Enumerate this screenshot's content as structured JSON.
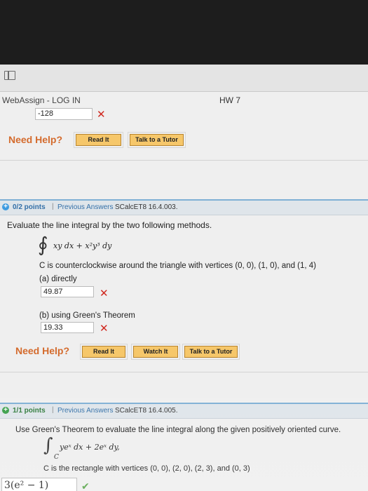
{
  "window": {
    "title_left": "WebAssign - LOG IN",
    "title_right": "HW 7"
  },
  "prev_problem": {
    "answer": "-128",
    "need_help": "Need Help?",
    "buttons": [
      "Read It",
      "Talk to a Tutor"
    ]
  },
  "q1": {
    "points": "0/2 points",
    "separator": "|",
    "previous_answers": "Previous Answers",
    "code": "SCalcET8 16.4.003.",
    "prompt": "Evaluate the line integral by the two following methods.",
    "integral_symbol": "∮",
    "integrand": "xy dx + x²y³ dy",
    "condition": "C is counterclockwise around the triangle with vertices (0, 0), (1, 0), and (1, 4)",
    "part_a_label": "(a) directly",
    "part_a_value": "49.87",
    "part_b_label": "(b) using Green's Theorem",
    "part_b_value": "19.33",
    "need_help": "Need Help?",
    "buttons": [
      "Read It",
      "Watch It",
      "Talk to a Tutor"
    ]
  },
  "q2": {
    "points": "1/1 points",
    "separator": "|",
    "previous_answers": "Previous Answers",
    "code": "SCalcET8 16.4.005.",
    "prompt": "Use Green's Theorem to evaluate the line integral along the given positively oriented curve.",
    "integral_symbol": "∫",
    "integral_sub": "C",
    "integrand": "yeˣ dx + 2eˣ dy,",
    "condition": "C is the rectangle with vertices (0, 0), (2, 0), (2, 3), and (0, 3)",
    "answer": "3(e² − 1)"
  },
  "icons": {
    "wrong": "✕",
    "correct": "✔",
    "sidebar": "sidebar-toggle-icon"
  }
}
